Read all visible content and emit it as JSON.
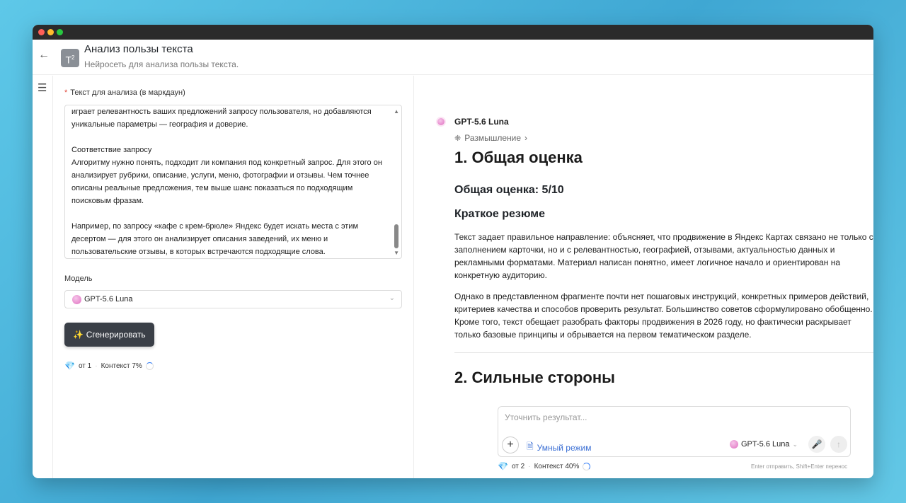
{
  "header": {
    "back_icon": "arrow-left-icon",
    "logo_text": "T",
    "logo_sup": "2",
    "title": "Анализ пользы текста",
    "subtitle": "Нейросеть для анализа пользы текста."
  },
  "sidebar": {
    "menu_icon": "hamburger-icon"
  },
  "form": {
    "text_label": "Текст для анализа (в маркдаун)",
    "required_mark": "*",
    "text_value": {
      "lines_top": [
        "играет релевантность ваших предложений запросу пользователя, но добавляются",
        "уникальные параметры — география и доверие."
      ],
      "lines_mid": [
        "Соответствие запросу",
        "Алгоритму нужно понять, подходит ли компания под конкретный запрос. Для этого он",
        "анализирует рубрики, описание, услуги, меню, фотографии и отзывы. Чем точнее",
        "описаны реальные предложения, тем выше шанс показаться по подходящим",
        "поисковым фразам."
      ],
      "lines_bottom": [
        "Например, по запросу «кафе с крем-брюле» Яндекс будет искать места с этим",
        "десертом — для этого он анализирует описания заведений, их меню и",
        "пользовательские отзывы, в которых встречаются подходящие слова."
      ]
    },
    "model_label": "Модель",
    "model_value": "GPT-5.6 Luna",
    "generate_label": "✨ Сгенерировать",
    "meta": {
      "cost": "от 1",
      "context": "Контекст 7%"
    }
  },
  "response": {
    "model_name": "GPT-5.6 Luna",
    "thinking_label": "Размышление",
    "h1": "1. Общая оценка",
    "score": "Общая оценка: 5/10",
    "summary_heading": "Краткое резюме",
    "para1": "Текст задает правильное направление: объясняет, что продвижение в Яндекс Картах связано не только с заполнением карточки, но и с релевантностью, географией, отзывами, актуальностью данных и рекламными форматами. Материал написан понятно, имеет логичное начало и ориентирован на конкретную аудиторию.",
    "para2": "Однако в представленном фрагменте почти нет пошаговых инструкций, конкретных примеров действий, критериев качества и способов проверить результат. Большинство советов сформулировано обобщенно. Кроме того, текст обещает разобрать факторы продвижения в 2026 году, но фактически раскрывает только базовые принципы и обрывается на первом тематическом разделе.",
    "h1_second": "2. Сильные стороны"
  },
  "composer": {
    "placeholder": "Уточнить результат...",
    "smart_mode": "Умный режим",
    "model": "GPT-5.6 Luna",
    "meta": {
      "cost": "от 2",
      "context": "Контекст 40%"
    },
    "hint": "Enter отправить, Shift+Enter перенос"
  }
}
